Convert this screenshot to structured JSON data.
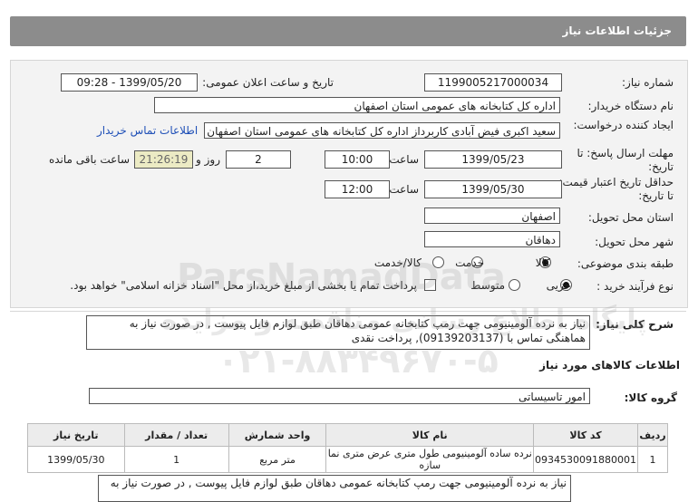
{
  "header": {
    "title": "جزئیات اطلاعات نیاز"
  },
  "form": {
    "need_number": {
      "label": "شماره نیاز:",
      "value": "1199005217000034"
    },
    "announce_datetime": {
      "label": "تاریخ و ساعت اعلان عمومی:",
      "value": "1399/05/20 - 09:28"
    },
    "buyer_org": {
      "label": "نام دستگاه خریدار:",
      "value": "اداره کل کتابخانه های عمومی استان اصفهان"
    },
    "creator": {
      "label": "ایجاد کننده درخواست:",
      "value": "سعید اکبری فیض آبادی کاربرداز اداره کل کتابخانه های عمومی استان اصفهان",
      "contact_link": "اطلاعات تماس خریدار"
    },
    "deadline": {
      "label": "مهلت ارسال پاسخ: تا تاریخ:",
      "date": "1399/05/23",
      "time_label": "ساعت",
      "time": "10:00",
      "days": "2",
      "days_label": "روز و",
      "countdown": "21:26:19",
      "remaining_label": "ساعت باقی مانده"
    },
    "validity": {
      "label": "حداقل تاریخ اعتبار قیمت: تا تاریخ:",
      "date": "1399/05/30",
      "time_label": "ساعت",
      "time": "12:00"
    },
    "province": {
      "label": "استان محل تحویل:",
      "value": "اصفهان"
    },
    "city": {
      "label": "شهر محل تحویل:",
      "value": "دهاقان"
    },
    "category": {
      "label": "طبقه بندی موضوعی:",
      "options": [
        "کالا",
        "خدمت",
        "کالا/خدمت"
      ],
      "selected": "کالا"
    },
    "purchase_process": {
      "label": "نوع فرآیند خرید :",
      "options": [
        "جزیی",
        "متوسط"
      ],
      "selected": "جزیی",
      "payment_note": "پرداخت تمام یا بخشی از مبلغ خرید،از محل \"اسناد خزانه اسلامی\" خواهد بود."
    }
  },
  "description": {
    "label": "شرح کلی نیاز:",
    "text": "نیاز به نرده آلومینیومی جهت رمپ کتابخانه عمومی دهاقان طبق لوازم فایل پیوست , در صورت نیاز به هماهنگی تماس با (09139203137), پرداخت نقدی"
  },
  "goods_section": {
    "title": "اطلاعات کالاهای مورد نیاز",
    "group_label": "گروه کالا:",
    "group_value": "امور تاسیساتی"
  },
  "table": {
    "headers": [
      "ردیف",
      "کد کالا",
      "نام کالا",
      "واحد شمارش",
      "تعداد / مقدار",
      "تاریخ نیاز"
    ],
    "rows": [
      [
        "1",
        "0934530091880001",
        "نرده ساده آلومینیومی طول متری عرض متری نما سازه",
        "متر مربع",
        "1",
        "1399/05/30"
      ]
    ]
  },
  "bottom_note": "نیاز به نرده آلومینیومی جهت رمپ کتابخانه عمومی دهاقان طبق لوازم فایل پیوست , در صورت نیاز به",
  "watermark": {
    "brand": "ParsNamadData",
    "line1": "پایگاه اطلاع رسانی مناقصه و مزایده",
    "phone": "۰۲۱-۸۸۳۴۹۶۷۰-۵"
  }
}
